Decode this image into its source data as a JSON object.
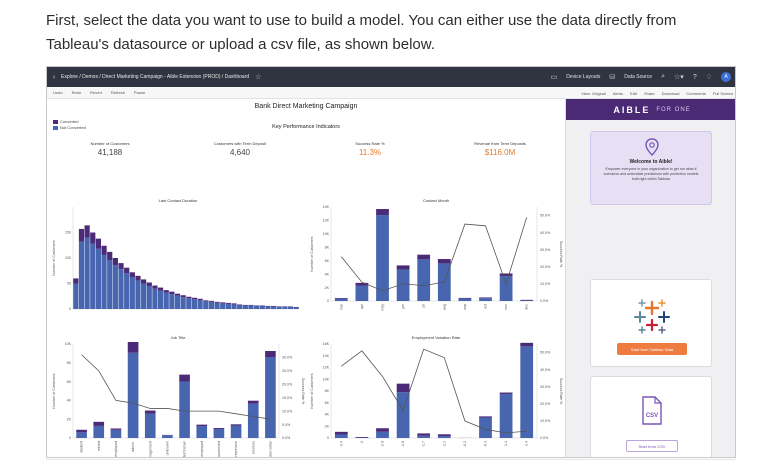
{
  "intro": {
    "line1": "First, select the data you want to use to build a model. You can either use the data directly from",
    "line2": "Tableau's datasource or upload a csv file, as shown below."
  },
  "titlebar": {
    "breadcrumb": "Explore / Demos / Direct Marketing Campaign - Aible Extension (PROD) / Dashboard",
    "device_layouts": "Device Layouts",
    "data_source": "Data Source",
    "avatar_initial": "A"
  },
  "toolbar": {
    "left": [
      "Undo",
      "Redo",
      "Revert",
      "Refresh",
      "Pause"
    ],
    "right": [
      "View: Original",
      "Alerts",
      "Edit",
      "Share",
      "Download",
      "Comments",
      "Full Screen"
    ]
  },
  "dashboard": {
    "title": "Bank Direct Marketing Campaign",
    "legend": [
      {
        "label": "Converted",
        "color": "#4b2a78"
      },
      {
        "label": "Not Converted",
        "color": "#4866b0"
      }
    ],
    "kpi_title": "Key Performance Indicators",
    "kpis": [
      {
        "label": "Number of Customers",
        "value": "41,188"
      },
      {
        "label": "Customers with Term Deposit",
        "value": "4,640"
      },
      {
        "label": "Success Rate %",
        "value": "11.3%"
      },
      {
        "label": "Revenue from Term Deposits",
        "value": "$116.0M"
      }
    ]
  },
  "colors": {
    "converted": "#4b2a78",
    "not_converted": "#4866b0",
    "rate_line": "#555555",
    "brand_purple": "#4a2a74",
    "orange": "#ee7b3f"
  },
  "chart_data": [
    {
      "type": "bar",
      "title": "Last Contact Duration",
      "ylabel": "Number of Customers",
      "ylim": [
        0,
        200
      ],
      "yticks": [
        0,
        50,
        100,
        150
      ],
      "series": [
        {
          "name": "Converted",
          "values": [
            10,
            25,
            24,
            22,
            20,
            18,
            16,
            14,
            12,
            11,
            10,
            9,
            8,
            7,
            6,
            6,
            5,
            5,
            4,
            4,
            3,
            3,
            3,
            2,
            2,
            2,
            2,
            2,
            2,
            1,
            1,
            1,
            1,
            1,
            1,
            1,
            1,
            1,
            1,
            1
          ]
        },
        {
          "name": "Not Converted",
          "values": [
            50,
            132,
            140,
            128,
            118,
            106,
            96,
            86,
            78,
            70,
            62,
            56,
            50,
            45,
            40,
            36,
            32,
            29,
            26,
            23,
            21,
            19,
            17,
            15,
            14,
            12,
            11,
            10,
            9,
            8,
            7,
            7,
            6,
            6,
            5,
            5,
            4,
            4,
            4,
            3
          ]
        }
      ]
    },
    {
      "type": "bar",
      "title": "Contact Month",
      "ylabel": "Number of Customers",
      "y2label": "Success Rate %",
      "ylim": [
        0,
        14000
      ],
      "yticks": [
        0,
        2000,
        4000,
        6000,
        8000,
        10000,
        12000,
        14000
      ],
      "y2lim": [
        0,
        55
      ],
      "y2ticks": [
        0,
        10,
        20,
        30,
        40,
        50
      ],
      "categories": [
        "mar",
        "apr",
        "may",
        "jun",
        "jul",
        "aug",
        "sep",
        "oct",
        "nov",
        "dec"
      ],
      "series": [
        {
          "name": "Converted",
          "values": [
            100,
            400,
            900,
            600,
            700,
            650,
            100,
            100,
            400,
            100
          ]
        },
        {
          "name": "Not Converted",
          "values": [
            350,
            2300,
            12800,
            4700,
            6200,
            5600,
            360,
            430,
            3700,
            70
          ]
        },
        {
          "name": "Success Rate %",
          "values": [
            26,
            11,
            6,
            10,
            9,
            11,
            45,
            44,
            10,
            49
          ]
        }
      ]
    },
    {
      "type": "bar",
      "title": "Job Title",
      "ylabel": "Number of Customers",
      "y2label": "Success Rate %",
      "ylim": [
        0,
        10000
      ],
      "yticks": [
        0,
        2000,
        4000,
        6000,
        8000,
        10000
      ],
      "y2lim": [
        0,
        35
      ],
      "y2ticks": [
        0,
        5,
        10,
        15,
        20,
        25,
        30
      ],
      "categories": [
        "student",
        "retired",
        "unemployed",
        "admin.",
        "management",
        "unknown",
        "technician",
        "self-employed",
        "housemaid",
        "entrepreneur",
        "services",
        "blue-collar"
      ],
      "series": [
        {
          "name": "Converted",
          "values": [
            275,
            434,
            144,
            1352,
            328,
            37,
            730,
            149,
            106,
            124,
            323,
            638
          ]
        },
        {
          "name": "Not Converted",
          "values": [
            600,
            1286,
            870,
            9070,
            2596,
            293,
            6013,
            1272,
            954,
            1332,
            3646,
            8616
          ]
        },
        {
          "name": "Success Rate %",
          "values": [
            31,
            25,
            14,
            13,
            11,
            11,
            10,
            10,
            10,
            9,
            8,
            7
          ]
        }
      ]
    },
    {
      "type": "bar",
      "title": "Employment Variation Rate",
      "ylabel": "Number of Customers",
      "y2label": "Success Rate %",
      "ylim": [
        0,
        16000
      ],
      "yticks": [
        0,
        2000,
        4000,
        6000,
        8000,
        10000,
        12000,
        14000,
        16000
      ],
      "y2lim": [
        0,
        55
      ],
      "y2ticks": [
        0,
        10,
        20,
        30,
        40,
        50
      ],
      "categories": [
        "-3.4",
        "-3",
        "-2.9",
        "-1.8",
        "-1.7",
        "-1.1",
        "-0.2",
        "-0.1",
        "1.1",
        "1.4"
      ],
      "series": [
        {
          "name": "Converted",
          "values": [
            450,
            90,
            600,
            1450,
            400,
            300,
            10,
            200,
            240,
            600
          ]
        },
        {
          "name": "Not Converted",
          "values": [
            600,
            80,
            1060,
            7800,
            380,
            330,
            10,
            3480,
            7500,
            15600
          ]
        },
        {
          "name": "Success Rate %",
          "values": [
            42,
            51,
            36,
            16,
            52,
            47,
            10,
            5,
            3,
            4
          ]
        }
      ]
    }
  ],
  "sidebar": {
    "logo": "AIBLE",
    "logo_sub": "FOR ONE",
    "welcome_title": "Welcome to Aible!",
    "welcome_text": "Empower everyone in your organization to get run what-if scenarios and actionable predictions with prediction models built right within Tableau",
    "tableau_button": "Start from Tableau Data",
    "csv_label": "CSV",
    "csv_button": "Start from CSV"
  }
}
